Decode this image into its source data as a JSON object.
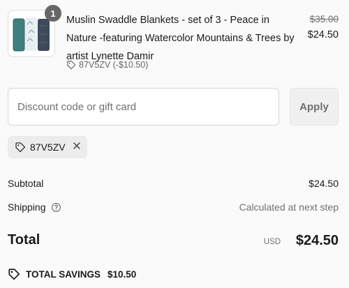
{
  "product": {
    "quantity": "1",
    "title": "Muslin Swaddle Blankets - set of 3 - Peace in Nature -featuring Watercolor Mountains & Trees by artist Lynette Damir",
    "discount_line": "87V5ZV (-$10.50)",
    "price_original": "$35.00",
    "price_current": "$24.50",
    "image_icon": "swaddle-blankets-thumbnail"
  },
  "discount": {
    "placeholder": "Discount code or gift card",
    "apply_label": "Apply",
    "applied_code": "87V5ZV"
  },
  "summary": {
    "subtotal_label": "Subtotal",
    "subtotal_value": "$24.50",
    "shipping_label": "Shipping",
    "shipping_value": "Calculated at next step",
    "total_label": "Total",
    "currency": "USD",
    "total_value": "$24.50",
    "savings_label": "TOTAL SAVINGS",
    "savings_value": "$10.50"
  },
  "colors": {
    "background": "#fafafa",
    "text": "#1a1a1a",
    "muted": "#707070",
    "badge": "#666666",
    "chip": "#ececec"
  }
}
